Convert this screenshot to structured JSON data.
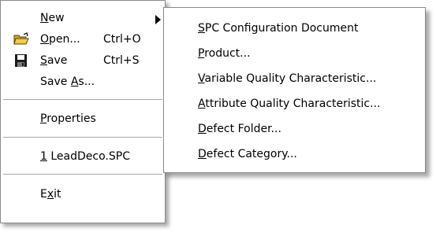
{
  "file_menu": {
    "new": {
      "pre": "",
      "key": "N",
      "post": "ew"
    },
    "open": {
      "pre": "",
      "key": "O",
      "post": "pen...",
      "shortcut": "Ctrl+O"
    },
    "save": {
      "pre": "",
      "key": "S",
      "post": "ave",
      "shortcut": "Ctrl+S"
    },
    "save_as": {
      "pre": "Save ",
      "key": "A",
      "post": "s..."
    },
    "properties": {
      "pre": "",
      "key": "P",
      "post": "roperties"
    },
    "recent": {
      "pre": "",
      "key": "1",
      "post": " LeadDeco.SPC"
    },
    "exit": {
      "pre": "E",
      "key": "x",
      "post": "it"
    },
    "icons": {
      "open": "folder-open-icon",
      "save": "floppy-disk-icon",
      "new": "submenu-arrow-icon"
    }
  },
  "new_submenu": {
    "items": [
      {
        "pre": "",
        "key": "S",
        "post": "PC Configuration Document"
      },
      {
        "pre": "",
        "key": "P",
        "post": "roduct..."
      },
      {
        "pre": "",
        "key": "V",
        "post": "ariable Quality Characteristic..."
      },
      {
        "pre": "",
        "key": "A",
        "post": "ttribute Quality Characteristic..."
      },
      {
        "pre": "",
        "key": "D",
        "post": "efect Folder..."
      },
      {
        "pre": "",
        "key": "D",
        "post": "efect Category..."
      }
    ]
  },
  "colors": {
    "menu_background": "#ffffff",
    "border": "#8a8a8a",
    "text": "#000000",
    "folder_icon": "#f2c94c",
    "floppy_icon": "#1a1a1a"
  }
}
